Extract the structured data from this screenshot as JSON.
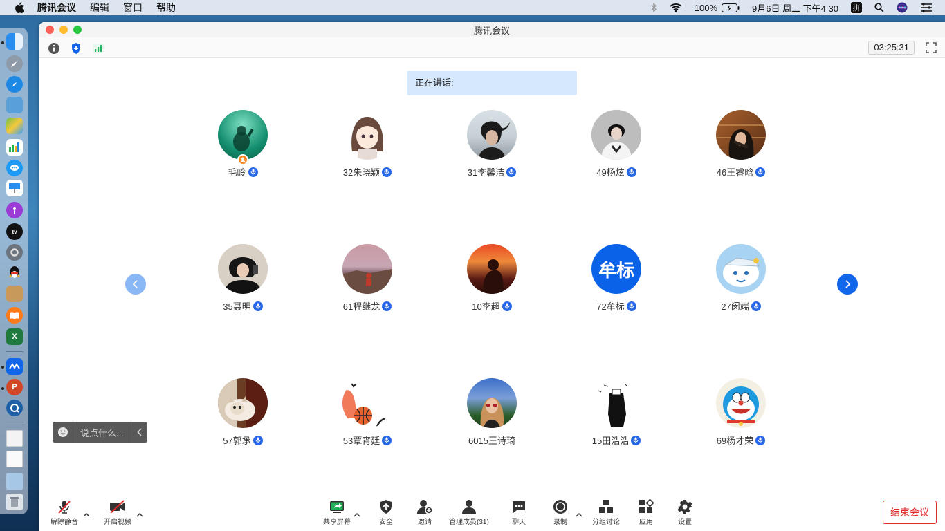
{
  "menubar": {
    "app_name": "腾讯会议",
    "items": [
      "编辑",
      "窗口",
      "帮助"
    ],
    "battery": "100%",
    "datetime": "9月6日 周二 下午4 30",
    "input_method": "拼"
  },
  "window": {
    "title": "腾讯会议",
    "timer": "03:25:31"
  },
  "speaking": {
    "label": "正在讲话:"
  },
  "participants": [
    {
      "name": "毛岭"
    },
    {
      "name": "32朱晓颖"
    },
    {
      "name": "31李馨洁"
    },
    {
      "name": "49杨炫"
    },
    {
      "name": "46王睿晗"
    },
    {
      "name": "35聂明"
    },
    {
      "name": "61程继龙"
    },
    {
      "name": "10李超"
    },
    {
      "name": "72牟标",
      "initials": "牟标"
    },
    {
      "name": "27闵端"
    },
    {
      "name": "57郭承"
    },
    {
      "name": "53覃宵廷"
    },
    {
      "name": "6015王诗琦"
    },
    {
      "name": "15田浩浩"
    },
    {
      "name": "69杨才荣"
    }
  ],
  "chat": {
    "placeholder": "说点什么..."
  },
  "controls": {
    "unmute": "解除静音",
    "video": "开启视频",
    "share": "共享屏幕",
    "security": "安全",
    "invite": "邀请",
    "members": "管理成员(31)",
    "chat": "聊天",
    "record": "录制",
    "breakout": "分组讨论",
    "apps": "应用",
    "settings": "设置",
    "end": "结束会议"
  },
  "colors": {
    "accent": "#1266ea",
    "end_red": "#e02b2b",
    "speaking_bg": "#d6e8fb"
  }
}
